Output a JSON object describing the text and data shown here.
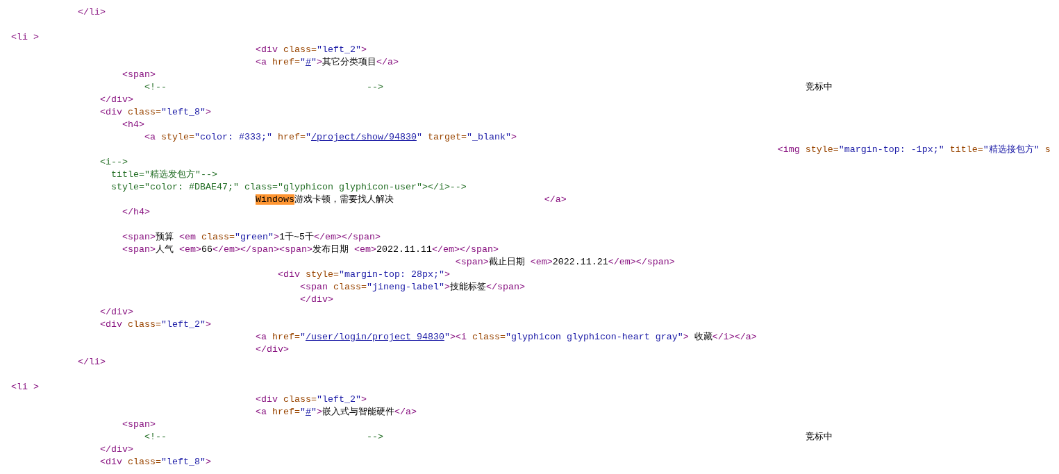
{
  "source_lines": [
    {
      "kind": "code",
      "tokens": [
        {
          "kind": "tag",
          "text": "\t      </li>"
        }
      ]
    },
    {
      "kind": "blank"
    },
    {
      "kind": "code",
      "tokens": [
        {
          "kind": "tag",
          "text": "  <li >"
        }
      ]
    },
    {
      "kind": "code",
      "tokens": [
        {
          "kind": "tag",
          "text": "\t\t\t\t\t      <div"
        },
        {
          "kind": "attr",
          "text": " class="
        },
        {
          "kind": "value",
          "text": "\"left_2\""
        },
        {
          "kind": "tag",
          "text": ">"
        }
      ]
    },
    {
      "kind": "code",
      "tokens": [
        {
          "kind": "tag",
          "text": "\t\t\t\t\t      <a"
        },
        {
          "kind": "attr",
          "text": " href="
        },
        {
          "kind": "value",
          "text": "\""
        },
        {
          "kind": "link",
          "text": "#"
        },
        {
          "kind": "value",
          "text": "\""
        },
        {
          "kind": "tag",
          "text": ">"
        },
        {
          "kind": "text",
          "text": "其它分类项目"
        },
        {
          "kind": "tag",
          "text": "</a>"
        }
      ]
    },
    {
      "kind": "code",
      "tokens": [
        {
          "kind": "tag",
          "text": "\t\t      <span>"
        }
      ]
    },
    {
      "kind": "code",
      "tokens": [
        {
          "kind": "comment",
          "text": "\t\t\t  <!--\t\t\t\t\t  -->"
        },
        {
          "kind": "text",
          "text": "\t\t\t\t\t\t\t\t\t\t 竞标中"
        }
      ]
    },
    {
      "kind": "code",
      "tokens": [
        {
          "kind": "tag",
          "text": "\t\t  </div>"
        }
      ]
    },
    {
      "kind": "code",
      "tokens": [
        {
          "kind": "tag",
          "text": "\t\t  <div"
        },
        {
          "kind": "attr",
          "text": " class="
        },
        {
          "kind": "value",
          "text": "\"left_8\""
        },
        {
          "kind": "tag",
          "text": ">"
        }
      ]
    },
    {
      "kind": "code",
      "tokens": [
        {
          "kind": "tag",
          "text": "\t\t      <h4>"
        }
      ]
    },
    {
      "kind": "code",
      "tokens": [
        {
          "kind": "tag",
          "text": "\t\t\t  <a"
        },
        {
          "kind": "attr",
          "text": " style="
        },
        {
          "kind": "value",
          "text": "\"color: #333;\""
        },
        {
          "kind": "attr",
          "text": " href="
        },
        {
          "kind": "value",
          "text": "\""
        },
        {
          "kind": "link",
          "text": "/project/show/94830"
        },
        {
          "kind": "value",
          "text": "\""
        },
        {
          "kind": "attr",
          "text": " target="
        },
        {
          "kind": "value",
          "text": "\"_blank\""
        },
        {
          "kind": "tag",
          "text": ">"
        }
      ]
    },
    {
      "kind": "code",
      "tokens": [
        {
          "kind": "tag",
          "text": "\t\t\t\t\t\t\t\t\t\t\t\t\t\t\t\t\t    <img"
        },
        {
          "kind": "attr",
          "text": " style="
        },
        {
          "kind": "value",
          "text": "\"margin-top: -1px;\""
        },
        {
          "kind": "attr",
          "text": " title="
        },
        {
          "kind": "value",
          "text": "\"精选接包方\""
        },
        {
          "kind": "attr",
          "text": " s"
        }
      ]
    },
    {
      "kind": "code",
      "tokens": [
        {
          "kind": "comment",
          "text": "\t\t  <i-->"
        }
      ]
    },
    {
      "kind": "code",
      "tokens": [
        {
          "kind": "comment",
          "text": "\t\t    title=\"精选发包方\"-->"
        }
      ]
    },
    {
      "kind": "code",
      "tokens": [
        {
          "kind": "comment",
          "text": "\t\t    style=\"color: #DBAE47;\" class=\"glyphicon glyphicon-user\"></i>-->"
        }
      ]
    },
    {
      "kind": "code",
      "tokens": [
        {
          "kind": "highlight",
          "text": "\t\t\t\t\t      Windows"
        },
        {
          "kind": "text",
          "text": "游戏卡顿，需要找人解决"
        },
        {
          "kind": "tag",
          "text": "\t\t\t\t  </a>"
        }
      ]
    },
    {
      "kind": "code",
      "tokens": [
        {
          "kind": "tag",
          "text": "\t\t      </h4>"
        }
      ]
    },
    {
      "kind": "blank"
    },
    {
      "kind": "code",
      "tokens": [
        {
          "kind": "tag",
          "text": "\t\t      <span>"
        },
        {
          "kind": "text",
          "text": "预算 "
        },
        {
          "kind": "tag",
          "text": "<em"
        },
        {
          "kind": "attr",
          "text": " class="
        },
        {
          "kind": "value",
          "text": "\"green\""
        },
        {
          "kind": "tag",
          "text": ">"
        },
        {
          "kind": "text",
          "text": "1千~5千"
        },
        {
          "kind": "tag",
          "text": "</em></span>"
        }
      ]
    },
    {
      "kind": "code",
      "tokens": [
        {
          "kind": "tag",
          "text": "\t\t      <span>"
        },
        {
          "kind": "text",
          "text": "人气 "
        },
        {
          "kind": "tag",
          "text": "<em>"
        },
        {
          "kind": "text",
          "text": "66"
        },
        {
          "kind": "tag",
          "text": "</em></span><span>"
        },
        {
          "kind": "text",
          "text": "发布日期 "
        },
        {
          "kind": "tag",
          "text": "<em>"
        },
        {
          "kind": "text",
          "text": "2022.11.11"
        },
        {
          "kind": "tag",
          "text": "</em></span>"
        }
      ]
    },
    {
      "kind": "code",
      "tokens": [
        {
          "kind": "tag",
          "text": "\t\t\t\t\t\t\t\t\t\t  <span>"
        },
        {
          "kind": "text",
          "text": "截止日期 "
        },
        {
          "kind": "tag",
          "text": "<em>"
        },
        {
          "kind": "text",
          "text": "2022.11.21"
        },
        {
          "kind": "tag",
          "text": "</em></span>"
        }
      ]
    },
    {
      "kind": "code",
      "tokens": [
        {
          "kind": "tag",
          "text": "\t\t\t\t\t\t  <div"
        },
        {
          "kind": "attr",
          "text": " style="
        },
        {
          "kind": "value",
          "text": "\"margin-top: 28px;\""
        },
        {
          "kind": "tag",
          "text": ">"
        }
      ]
    },
    {
      "kind": "code",
      "tokens": [
        {
          "kind": "tag",
          "text": "\t\t\t\t\t\t      <span"
        },
        {
          "kind": "attr",
          "text": " class="
        },
        {
          "kind": "value",
          "text": "\"jineng-label\""
        },
        {
          "kind": "tag",
          "text": ">"
        },
        {
          "kind": "text",
          "text": "技能标签"
        },
        {
          "kind": "tag",
          "text": "</span>"
        }
      ]
    },
    {
      "kind": "code",
      "tokens": [
        {
          "kind": "tag",
          "text": "\t\t\t\t\t\t      </div>"
        }
      ]
    },
    {
      "kind": "code",
      "tokens": [
        {
          "kind": "tag",
          "text": "\t\t  </div>"
        }
      ]
    },
    {
      "kind": "code",
      "tokens": [
        {
          "kind": "tag",
          "text": "\t\t  <div"
        },
        {
          "kind": "attr",
          "text": " class="
        },
        {
          "kind": "value",
          "text": "\"left_2\""
        },
        {
          "kind": "tag",
          "text": ">"
        }
      ]
    },
    {
      "kind": "code",
      "tokens": [
        {
          "kind": "tag",
          "text": "\t\t\t\t\t      <a"
        },
        {
          "kind": "attr",
          "text": " href="
        },
        {
          "kind": "value",
          "text": "\""
        },
        {
          "kind": "link",
          "text": "/user/login/project_94830"
        },
        {
          "kind": "value",
          "text": "\""
        },
        {
          "kind": "tag",
          "text": "><i"
        },
        {
          "kind": "attr",
          "text": " class="
        },
        {
          "kind": "value",
          "text": "\"glyphicon glyphicon-heart gray\""
        },
        {
          "kind": "tag",
          "text": ">"
        },
        {
          "kind": "text",
          "text": " 收藏"
        },
        {
          "kind": "tag",
          "text": "</i></a>"
        }
      ]
    },
    {
      "kind": "code",
      "tokens": [
        {
          "kind": "tag",
          "text": "\t\t\t\t\t      </div>"
        }
      ]
    },
    {
      "kind": "code",
      "tokens": [
        {
          "kind": "tag",
          "text": "\t      </li>"
        }
      ]
    },
    {
      "kind": "blank"
    },
    {
      "kind": "code",
      "tokens": [
        {
          "kind": "tag",
          "text": "  <li >"
        }
      ]
    },
    {
      "kind": "code",
      "tokens": [
        {
          "kind": "tag",
          "text": "\t\t\t\t\t      <div"
        },
        {
          "kind": "attr",
          "text": " class="
        },
        {
          "kind": "value",
          "text": "\"left_2\""
        },
        {
          "kind": "tag",
          "text": ">"
        }
      ]
    },
    {
      "kind": "code",
      "tokens": [
        {
          "kind": "tag",
          "text": "\t\t\t\t\t      <a"
        },
        {
          "kind": "attr",
          "text": " href="
        },
        {
          "kind": "value",
          "text": "\""
        },
        {
          "kind": "link",
          "text": "#"
        },
        {
          "kind": "value",
          "text": "\""
        },
        {
          "kind": "tag",
          "text": ">"
        },
        {
          "kind": "text",
          "text": "嵌入式与智能硬件"
        },
        {
          "kind": "tag",
          "text": "</a>"
        }
      ]
    },
    {
      "kind": "code",
      "tokens": [
        {
          "kind": "tag",
          "text": "\t\t      <span>"
        }
      ]
    },
    {
      "kind": "code",
      "tokens": [
        {
          "kind": "comment",
          "text": "\t\t\t  <!--\t\t\t\t\t  -->"
        },
        {
          "kind": "text",
          "text": "\t\t\t\t\t\t\t\t\t\t 竞标中"
        }
      ]
    },
    {
      "kind": "code",
      "tokens": [
        {
          "kind": "tag",
          "text": "\t\t  </div>"
        }
      ]
    },
    {
      "kind": "code",
      "tokens": [
        {
          "kind": "tag",
          "text": "\t\t  <div"
        },
        {
          "kind": "attr",
          "text": " class="
        },
        {
          "kind": "value",
          "text": "\"left_8\""
        },
        {
          "kind": "tag",
          "text": ">"
        }
      ]
    }
  ]
}
